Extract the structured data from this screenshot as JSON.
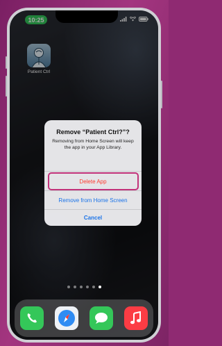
{
  "status_bar": {
    "time": "10:25"
  },
  "home_screen": {
    "apps": [
      {
        "label": "Patient Ctrl",
        "icon": "patient-ctrl-app-icon"
      }
    ],
    "page_dots": {
      "count": 6,
      "active_index": 5
    }
  },
  "alert": {
    "title": "Remove “Patient Ctrl?”?",
    "message": "Removing from Home Screen will keep the app in your App Library.",
    "buttons": {
      "delete": "Delete App",
      "remove": "Remove from Home Screen",
      "cancel": "Cancel"
    }
  },
  "dock": [
    {
      "icon": "phone-icon",
      "color": "#34c759"
    },
    {
      "icon": "safari-icon",
      "color": "#2f8cf3"
    },
    {
      "icon": "messages-icon",
      "color": "#34c759"
    },
    {
      "icon": "music-icon",
      "color": "#fc3c44"
    }
  ],
  "colors": {
    "background": "#8f2a72",
    "highlight_ring": "#c2327a",
    "destructive": "#ff3b30",
    "action": "#1a73e8"
  }
}
